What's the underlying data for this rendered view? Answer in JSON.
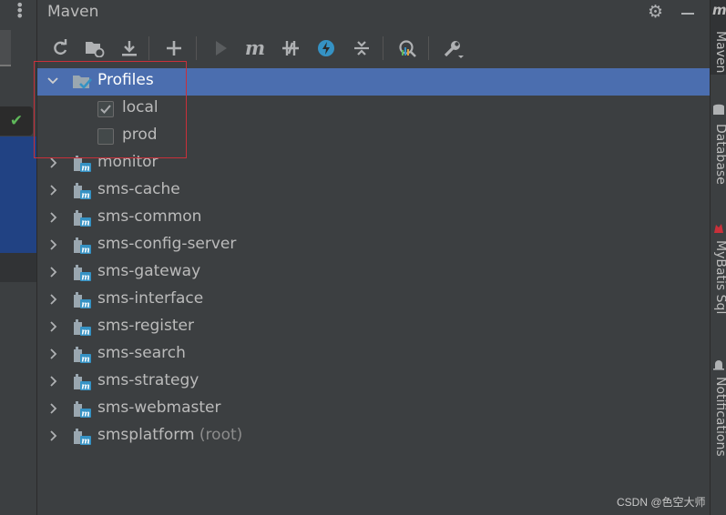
{
  "maven": {
    "title": "Maven"
  },
  "toolbar": {
    "buttons": [
      "reload-icon",
      "add-maven-projects-icon",
      "download-icon",
      "add-icon",
      "run-icon",
      "execute-goal-icon",
      "toggle-offline-icon",
      "toggle-skip-tests-icon",
      "collapse-all-icon",
      "analyze-dependencies-icon",
      "settings-wrench-icon"
    ]
  },
  "tree": {
    "profiles_label": "Profiles",
    "profiles": [
      {
        "label": "local",
        "checked": true
      },
      {
        "label": "prod",
        "checked": false
      }
    ],
    "modules": [
      {
        "label": "monitor"
      },
      {
        "label": "sms-cache"
      },
      {
        "label": "sms-common"
      },
      {
        "label": "sms-config-server"
      },
      {
        "label": "sms-gateway"
      },
      {
        "label": "sms-interface"
      },
      {
        "label": "sms-register"
      },
      {
        "label": "sms-search"
      },
      {
        "label": "sms-strategy"
      },
      {
        "label": "sms-webmaster"
      }
    ],
    "root": {
      "label": "smsplatform",
      "suffix": "(root)"
    }
  },
  "right_tabs": [
    "Maven",
    "Database",
    "MyBatis Sql",
    "Notifications"
  ],
  "watermark": "CSDN @色空大师",
  "colors": {
    "selection": "#4b6eaf",
    "panel": "#3c3f41",
    "highlight_box": "#c9303a",
    "accent_blue": "#3592c4"
  }
}
